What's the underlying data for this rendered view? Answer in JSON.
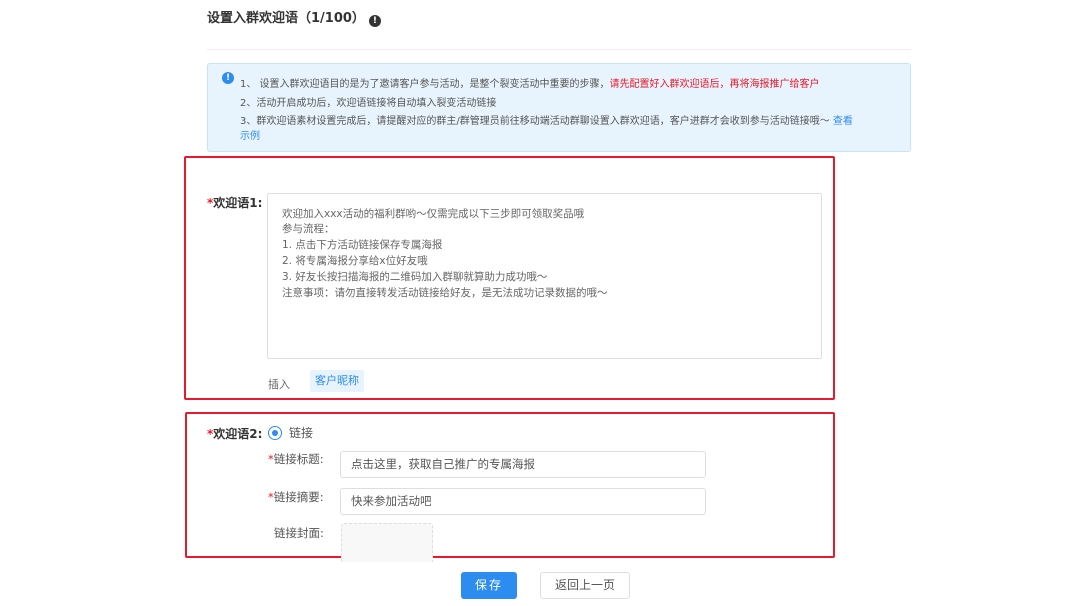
{
  "header": {
    "title": "设置入群欢迎语（1/100）",
    "title_icon": "!"
  },
  "notice": {
    "icon": "!",
    "line1_a": "1、 设置入群欢迎语目的是为了邀请客户参与活动，是整个裂变活动中重要的步骤，",
    "line1_red": "请先配置好入群欢迎语后，再将海报推广给客户",
    "line2": "2、活动开启成功后，欢迎语链接将自动填入裂变活动链接",
    "line3_a": "3、群欢迎语素材设置完成后，请提醒对应的群主/群管理员前往移动端活动群聊设置入群欢迎语，客户进群才会收到参与活动链接哦～ ",
    "line3_link": "查看",
    "line4_link": "示例"
  },
  "welcome1": {
    "required_mark": "*",
    "label": "欢迎语1:",
    "lines": [
      "欢迎加入xxx活动的福利群哟～仅需完成以下三步即可领取奖品哦",
      "参与流程：",
      "1. 点击下方活动链接保存专属海报",
      "2. 将专属海报分享给x位好友哦",
      "3. 好友长按扫描海报的二维码加入群聊就算助力成功哦～",
      "注意事项：请勿直接转发活动链接给好友，是无法成功记录数据的哦～"
    ],
    "insert_label": "插入",
    "insert_tag": "客户昵称"
  },
  "welcome2": {
    "required_mark": "*",
    "label": "欢迎语2:",
    "radio_label": "链接",
    "link_title_label": "链接标题:",
    "link_title_value": "点击这里，获取自己推广的专属海报",
    "link_summary_label": "链接摘要:",
    "link_summary_value": "快来参加活动吧",
    "link_cover_label": "链接封面:"
  },
  "buttons": {
    "save": "保存",
    "back": "返回上一页"
  },
  "colors": {
    "accent": "#2d8cf0",
    "danger": "#e8192c",
    "notice_bg": "#e8f4fd"
  }
}
